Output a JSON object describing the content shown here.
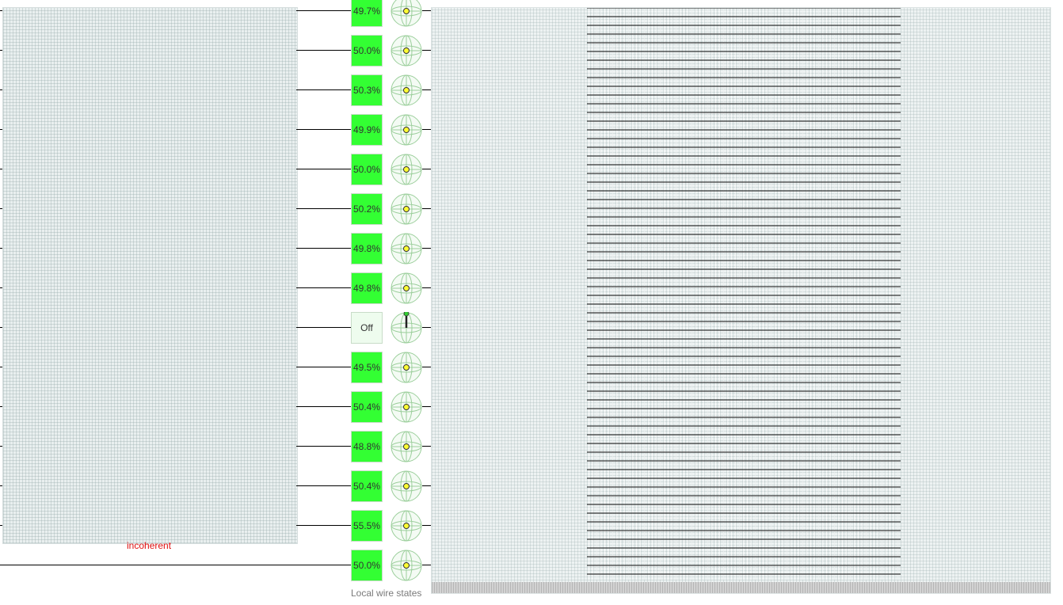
{
  "left_panel": {
    "status_label": "incoherent"
  },
  "wire_states": [
    {
      "label": "49.7%",
      "state": "on"
    },
    {
      "label": "50.0%",
      "state": "on"
    },
    {
      "label": "50.3%",
      "state": "on"
    },
    {
      "label": "49.9%",
      "state": "on"
    },
    {
      "label": "50.0%",
      "state": "on"
    },
    {
      "label": "50.2%",
      "state": "on"
    },
    {
      "label": "49.8%",
      "state": "on"
    },
    {
      "label": "49.8%",
      "state": "on"
    },
    {
      "label": "Off",
      "state": "off"
    },
    {
      "label": "49.5%",
      "state": "on"
    },
    {
      "label": "50.4%",
      "state": "on"
    },
    {
      "label": "48.8%",
      "state": "on"
    },
    {
      "label": "50.4%",
      "state": "on"
    },
    {
      "label": "55.5%",
      "state": "on"
    },
    {
      "label": "50.0%",
      "state": "on"
    }
  ],
  "wire_states_footer": "Local wire states",
  "colors": {
    "on_fill": "#33ff33",
    "off_fill": "#eefcee",
    "bloch_dot": "#ffff33",
    "bloch_vector": "#222222",
    "bloch_vector_tip": "#33cc33",
    "incoherent_label": "#e01010"
  }
}
